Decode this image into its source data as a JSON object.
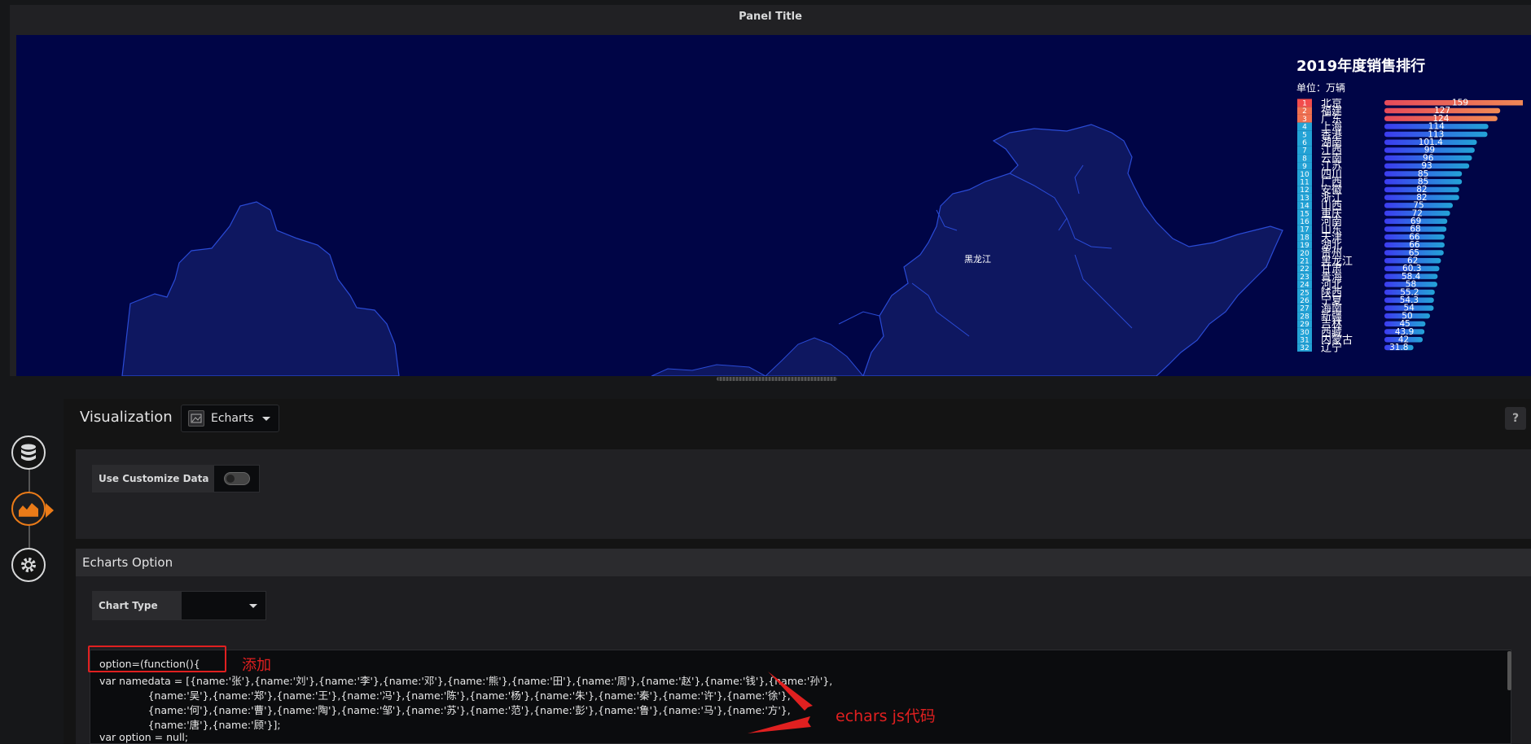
{
  "panel": {
    "title": "Panel Title"
  },
  "map": {
    "region_label": "黑龙江",
    "background": "#000546",
    "land_fill": "#0e1760",
    "border": "#2a4bd6"
  },
  "ranking": {
    "title": "2019年度销售排行",
    "unit": "单位：万辆",
    "top_colors": [
      "#f24c4c",
      "#f07050"
    ],
    "other_color": "#23a3d6",
    "bar_gradient_start": "#3c3cf0",
    "bar_gradient_end_top": "#f08a55",
    "bar_gradient_end": "#23a3d6",
    "max_value": 159,
    "items": [
      {
        "rank": "1",
        "name": "北京",
        "value": 159
      },
      {
        "rank": "2",
        "name": "福建",
        "value": 127
      },
      {
        "rank": "3",
        "name": "广东",
        "value": 124
      },
      {
        "rank": "4",
        "name": "上海",
        "value": 114
      },
      {
        "rank": "5",
        "name": "香港",
        "value": 113
      },
      {
        "rank": "6",
        "name": "湖南",
        "value": 101.4
      },
      {
        "rank": "7",
        "name": "江西",
        "value": 99
      },
      {
        "rank": "8",
        "name": "云南",
        "value": 96
      },
      {
        "rank": "9",
        "name": "江苏",
        "value": 93
      },
      {
        "rank": "10",
        "name": "四川",
        "value": 85
      },
      {
        "rank": "11",
        "name": "广西",
        "value": 85
      },
      {
        "rank": "12",
        "name": "安徽",
        "value": 82
      },
      {
        "rank": "13",
        "name": "浙江",
        "value": 82
      },
      {
        "rank": "14",
        "name": "山西",
        "value": 75
      },
      {
        "rank": "15",
        "name": "重庆",
        "value": 72
      },
      {
        "rank": "16",
        "name": "河南",
        "value": 69
      },
      {
        "rank": "17",
        "name": "山东",
        "value": 68
      },
      {
        "rank": "18",
        "name": "天津",
        "value": 66
      },
      {
        "rank": "19",
        "name": "湖北",
        "value": 66
      },
      {
        "rank": "20",
        "name": "贵州",
        "value": 65
      },
      {
        "rank": "21",
        "name": "黑龙江",
        "value": 62
      },
      {
        "rank": "22",
        "name": "甘肃",
        "value": 60.3
      },
      {
        "rank": "23",
        "name": "青海",
        "value": 58.4
      },
      {
        "rank": "24",
        "name": "河北",
        "value": 58
      },
      {
        "rank": "25",
        "name": "陕西",
        "value": 55.2
      },
      {
        "rank": "26",
        "name": "宁夏",
        "value": 54.3
      },
      {
        "rank": "27",
        "name": "海南",
        "value": 54
      },
      {
        "rank": "28",
        "name": "新疆",
        "value": 50
      },
      {
        "rank": "29",
        "name": "吉林",
        "value": 45
      },
      {
        "rank": "30",
        "name": "西藏",
        "value": 43.9
      },
      {
        "rank": "31",
        "name": "内蒙古",
        "value": 42
      },
      {
        "rank": "32",
        "name": "辽宁",
        "value": 31.8
      }
    ]
  },
  "editor": {
    "visualization_label": "Visualization",
    "visualization_value": "Echarts",
    "help": "?",
    "use_customize_label": "Use Customize Data",
    "echarts_option_title": "Echarts Option",
    "chart_type_label": "Chart Type",
    "code_lines": [
      "option=(function(){",
      "var namedata = [{name:'张'},{name:'刘'},{name:'李'},{name:'邓'},{name:'熊'},{name:'田'},{name:'周'},{name:'赵'},{name:'钱'},{name:'孙'},",
      "               {name:'吴'},{name:'郑'},{name:'王'},{name:'冯'},{name:'陈'},{name:'杨'},{name:'朱'},{name:'秦'},{name:'许'},{name:'徐'},",
      "               {name:'何'},{name:'曹'},{name:'陶'},{name:'邹'},{name:'苏'},{name:'范'},{name:'彭'},{name:'鲁'},{name:'马'},{name:'方'},",
      "               {name:'唐'},{name:'顾'}];",
      "var option = null;"
    ]
  },
  "annotations": {
    "add_label": "添加",
    "code_label": "echars js代码",
    "color": "#e02020"
  },
  "sidebar": {
    "items": [
      {
        "name": "queries",
        "icon": "database-icon"
      },
      {
        "name": "visualization",
        "icon": "area-chart-icon",
        "active": true
      },
      {
        "name": "general",
        "icon": "gear-icon"
      }
    ],
    "active_color": "#eb7b18"
  }
}
